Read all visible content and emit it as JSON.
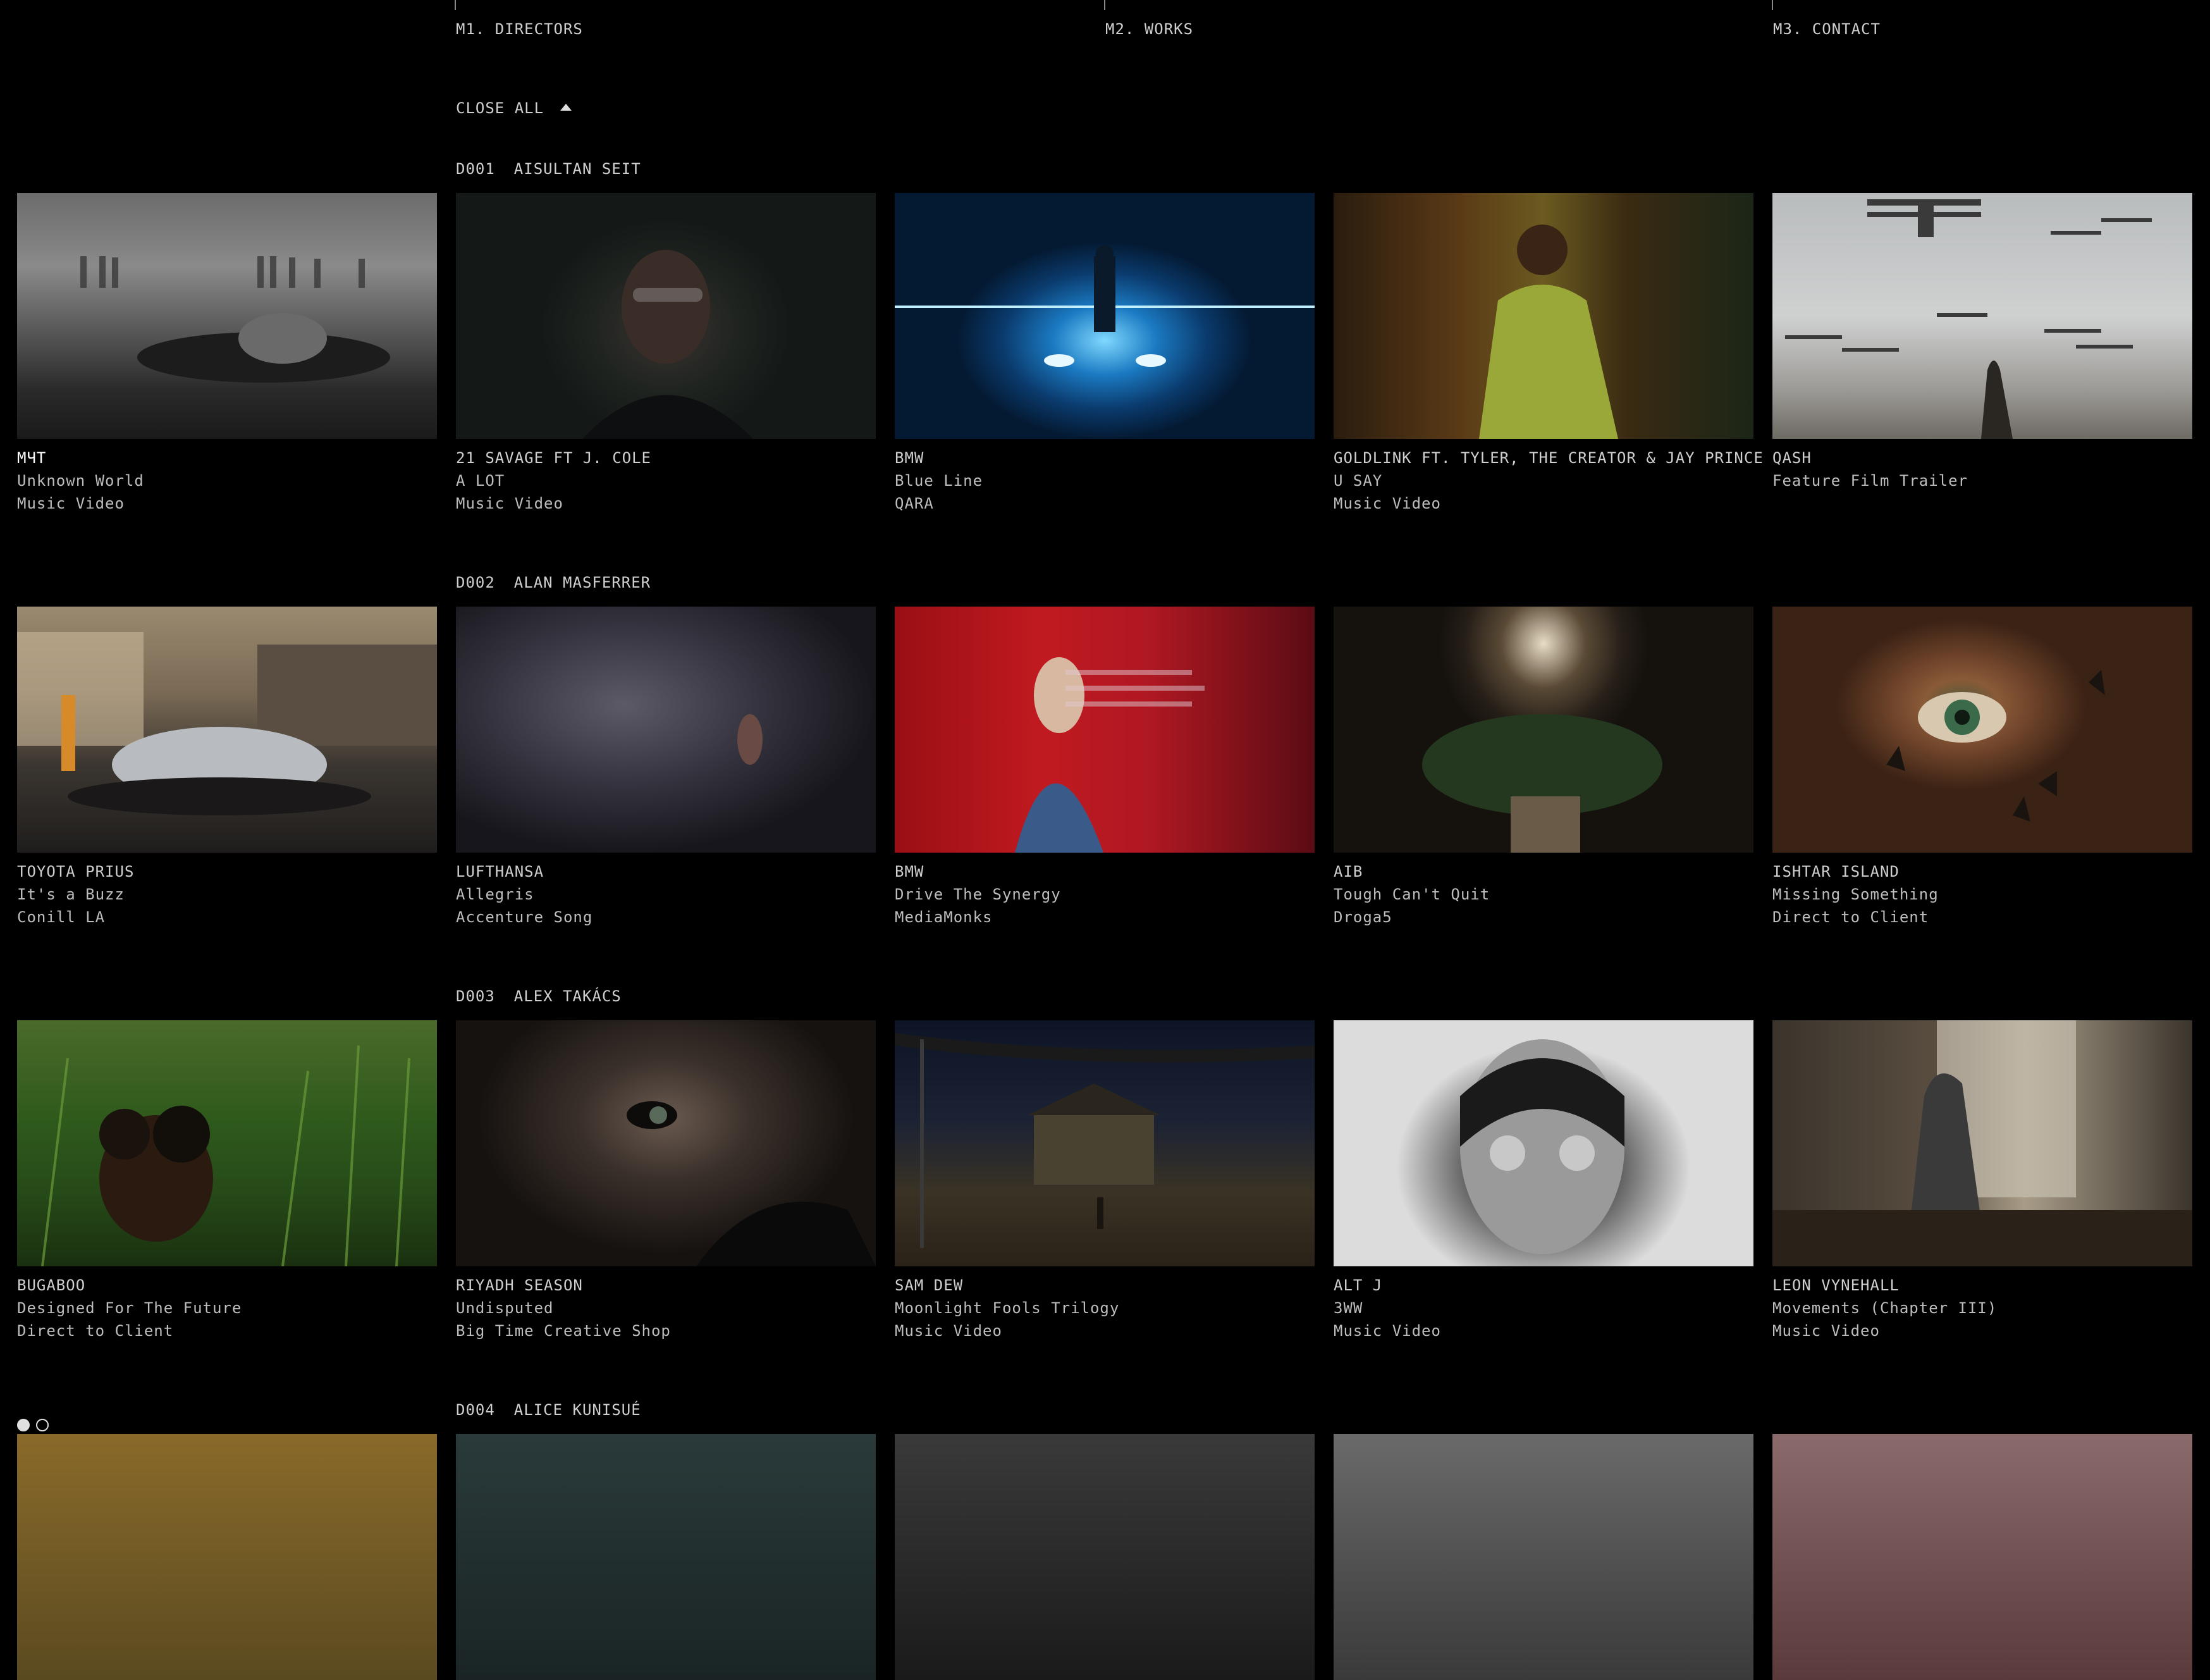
{
  "nav": {
    "items": [
      {
        "label": "M1. DIRECTORS"
      },
      {
        "label": "M2. WORKS"
      },
      {
        "label": "M3. CONTACT"
      }
    ]
  },
  "close_all": "CLOSE ALL",
  "icons": {
    "close_all": "caret-up-icon",
    "pager": "pager-dot-icon"
  },
  "sections": [
    {
      "code": "D001",
      "name": "AISULTAN SEIT",
      "works": [
        {
          "client": "МЧТ",
          "title": "Unknown World",
          "agency": "Music Video"
        },
        {
          "client": "21 SAVAGE FT J. COLE",
          "title": "A LOT",
          "agency": "Music Video"
        },
        {
          "client": "BMW",
          "title": "Blue Line",
          "agency": "QARA"
        },
        {
          "client": "GOLDLINK FT. TYLER, THE CREATOR & JAY PRINCE",
          "title": "U SAY",
          "agency": "Music Video"
        },
        {
          "client": "QASH",
          "title": "Feature Film Trailer",
          "agency": ""
        }
      ]
    },
    {
      "code": "D002",
      "name": "ALAN MASFERRER",
      "works": [
        {
          "client": "TOYOTA PRIUS",
          "title": "It's a Buzz",
          "agency": "Conill LA"
        },
        {
          "client": "LUFTHANSA",
          "title": "Allegris",
          "agency": "Accenture Song"
        },
        {
          "client": "BMW",
          "title": "Drive The Synergy",
          "agency": "MediaMonks"
        },
        {
          "client": "AIB",
          "title": "Tough Can't Quit",
          "agency": "Droga5"
        },
        {
          "client": "ISHTAR ISLAND",
          "title": "Missing Something",
          "agency": "Direct to Client"
        }
      ]
    },
    {
      "code": "D003",
      "name": "ALEX TAKÁCS",
      "works": [
        {
          "client": "BUGABOO",
          "title": "Designed For The Future",
          "agency": "Direct to Client"
        },
        {
          "client": "RIYADH SEASON",
          "title": "Undisputed",
          "agency": "Big Time Creative Shop"
        },
        {
          "client": "SAM DEW",
          "title": "Moonlight Fools Trilogy",
          "agency": "Music Video"
        },
        {
          "client": "ALT J",
          "title": "3WW",
          "agency": "Music Video"
        },
        {
          "client": "LEON VYNEHALL",
          "title": "Movements (Chapter III)",
          "agency": "Music Video"
        }
      ]
    },
    {
      "code": "D004",
      "name": "ALICE KUNISUÉ",
      "works": []
    }
  ],
  "colors": {
    "background": "#000000",
    "text": "#cfcfcf",
    "accent": "#ffffff"
  }
}
